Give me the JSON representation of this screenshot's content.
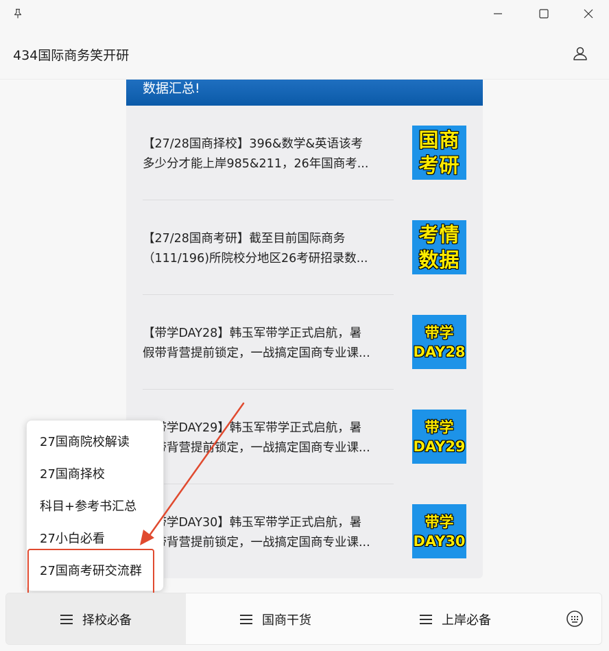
{
  "window": {
    "title": "434国际商务笑开研"
  },
  "banner": {
    "text": "数据汇总!"
  },
  "articles": [
    {
      "line1": "【27/28国商择校】396&数学&英语该考",
      "line2": "多少分才能上岸985&211，26年国商考...",
      "thumb_line1": "国商",
      "thumb_line2": "考研"
    },
    {
      "line1": "【27/28国商考研】截至目前国际商务",
      "line2": "（111/196)所院校分地区26考研招录数...",
      "thumb_line1": "考情",
      "thumb_line2": "数据"
    },
    {
      "line1": "【带学DAY28】韩玉军带学正式启航，暑",
      "line2": "假带背营提前锁定，一战搞定国商专业课...",
      "thumb_line1": "带学",
      "thumb_line2": "DAY28"
    },
    {
      "line1": "【带学DAY29】韩玉军带学正式启航，暑",
      "line2": "假带背营提前锁定，一战搞定国商专业课...",
      "thumb_line1": "带学",
      "thumb_line2": "DAY29"
    },
    {
      "line1": "【带学DAY30】韩玉军带学正式启航，暑",
      "line2": "假带背营提前锁定，一战搞定国商专业课...",
      "thumb_line1": "带学",
      "thumb_line2": "DAY30"
    }
  ],
  "popup_menu": {
    "items": [
      "27国商院校解读",
      "27国商择校",
      "科目+参考书汇总",
      "27小白必看",
      "27国商考研交流群"
    ]
  },
  "bottom_nav": {
    "tabs": [
      "择校必备",
      "国商干货",
      "上岸必备"
    ]
  },
  "colors": {
    "banner": "#0b5aa8",
    "thumb_bg": "#1d93e8",
    "thumb_text": "#ffec00",
    "annotation": "#e04a2f"
  }
}
